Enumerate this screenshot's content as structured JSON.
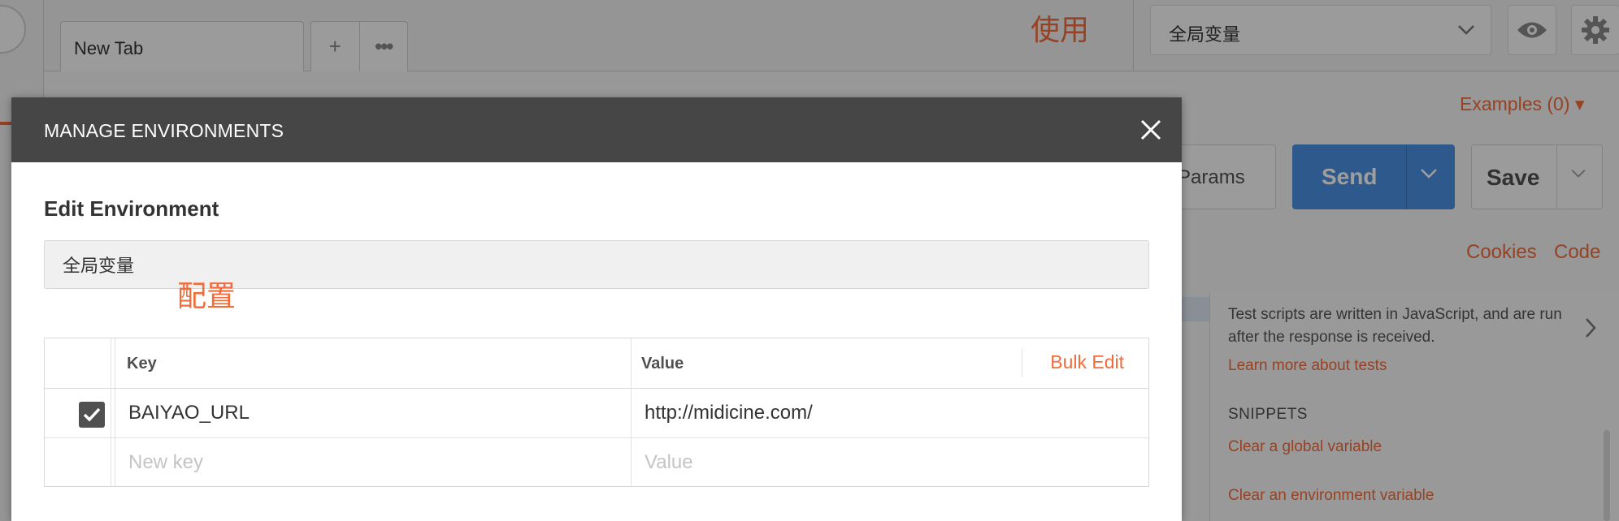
{
  "tabs": {
    "active_tab": "New Tab",
    "add_symbol": "+",
    "more_symbol": "•••"
  },
  "annotations": {
    "use": "使用",
    "config": "配置"
  },
  "environment_selector": {
    "selected": "全局变量",
    "eye_icon": "eye-icon",
    "gear_icon": "gear-icon"
  },
  "request": {
    "examples": "Examples (0) ▾",
    "params": "Params",
    "send": "Send",
    "save": "Save",
    "cookies": "Cookies",
    "code": "Code"
  },
  "tests_panel": {
    "description": "Test scripts are written in JavaScript, and are run after the response is received.",
    "learn_more": "Learn more about tests",
    "snippets_heading": "SNIPPETS",
    "snippets": [
      "Clear a global variable",
      "Clear an environment variable"
    ]
  },
  "modal": {
    "title": "MANAGE ENVIRONMENTS",
    "subtitle": "Edit Environment",
    "env_name_value": "全局变量",
    "table": {
      "key_header": "Key",
      "value_header": "Value",
      "bulk_edit": "Bulk Edit",
      "rows": [
        {
          "checked": true,
          "key": "BAIYAO_URL",
          "value": "http://midicine.com/"
        }
      ],
      "new_key_placeholder": "New key",
      "new_value_placeholder": "Value"
    }
  },
  "colors": {
    "accent": "#f26b3a",
    "send": "#4a90e2",
    "modal_header": "#464646"
  }
}
